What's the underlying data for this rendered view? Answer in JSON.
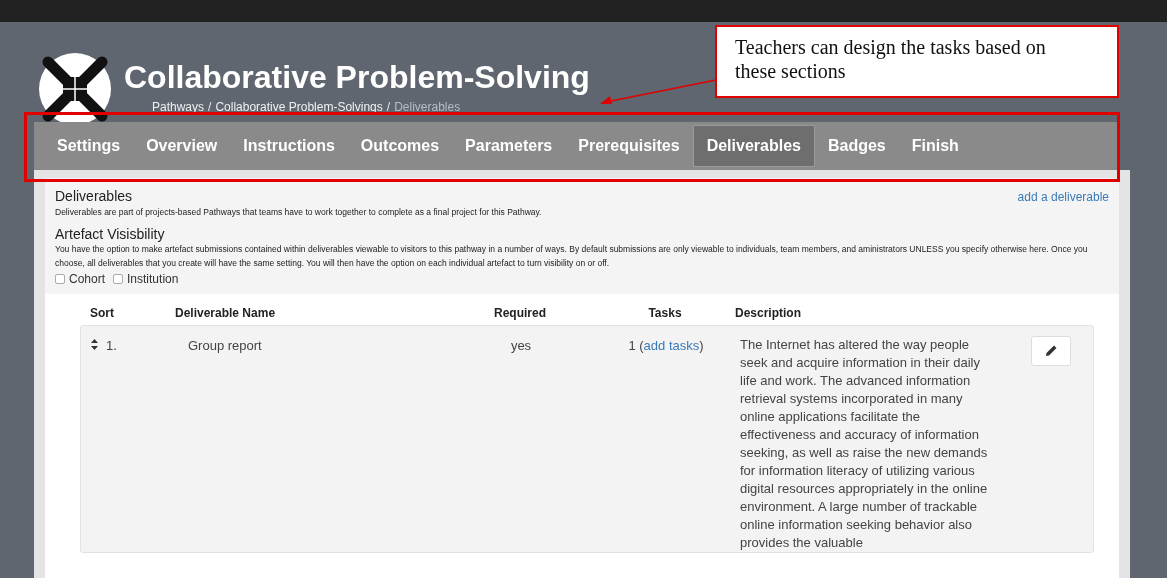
{
  "annotation": {
    "text": "Teachers can design the tasks based on these sections"
  },
  "header": {
    "title": "Collaborative Problem-Solving",
    "breadcrumb": [
      "Pathways",
      "Collaborative Problem-Solvings",
      "Deliverables"
    ],
    "separator": "/"
  },
  "tabs": [
    {
      "label": "Settings",
      "selected": false
    },
    {
      "label": "Overview",
      "selected": false
    },
    {
      "label": "Instructions",
      "selected": false
    },
    {
      "label": "Outcomes",
      "selected": false
    },
    {
      "label": "Parameters",
      "selected": false
    },
    {
      "label": "Prerequisites",
      "selected": false
    },
    {
      "label": "Deliverables",
      "selected": true
    },
    {
      "label": "Badges",
      "selected": false
    },
    {
      "label": "Finish",
      "selected": false
    }
  ],
  "deliverables": {
    "title": "Deliverables",
    "text": "Deliverables are part of projects-based Pathways that teams have to work together to complete as a final project for this Pathway.",
    "link": "add a deliverable"
  },
  "visibility": {
    "title": "Artefact Visisbility",
    "text": "You have the option to make artefact submissions contained within deliverables viewable to visitors to this pathway in a number of ways. By default submissions are only viewable to individuals, team members, and aministrators UNLESS you specify otherwise here. Once you choose, all deliverables that you create will have the same setting. You will then have the option on each individual artefact to turn visibility on or off.",
    "options": [
      {
        "label": "Cohort",
        "checked": false
      },
      {
        "label": "Institution",
        "checked": false
      }
    ]
  },
  "table": {
    "columns": [
      "Sort",
      "Deliverable Name",
      "Required",
      "Tasks",
      "Description"
    ],
    "rows": [
      {
        "sort": "1.",
        "name": "Group report",
        "required": "yes",
        "tasks_count": "1 (",
        "tasks_link": "add tasks",
        "tasks_end": ")",
        "description": "The Internet has altered the way people seek and acquire information in their daily life and work. The advanced information retrieval systems incorporated in many online applications facilitate the effectiveness and accuracy of information seeking, as well as raise the new demands for information literacy of utilizing various digital resources appropriately in the online environment. A large number of trackable online information seeking behavior also provides the valuable"
      }
    ]
  }
}
